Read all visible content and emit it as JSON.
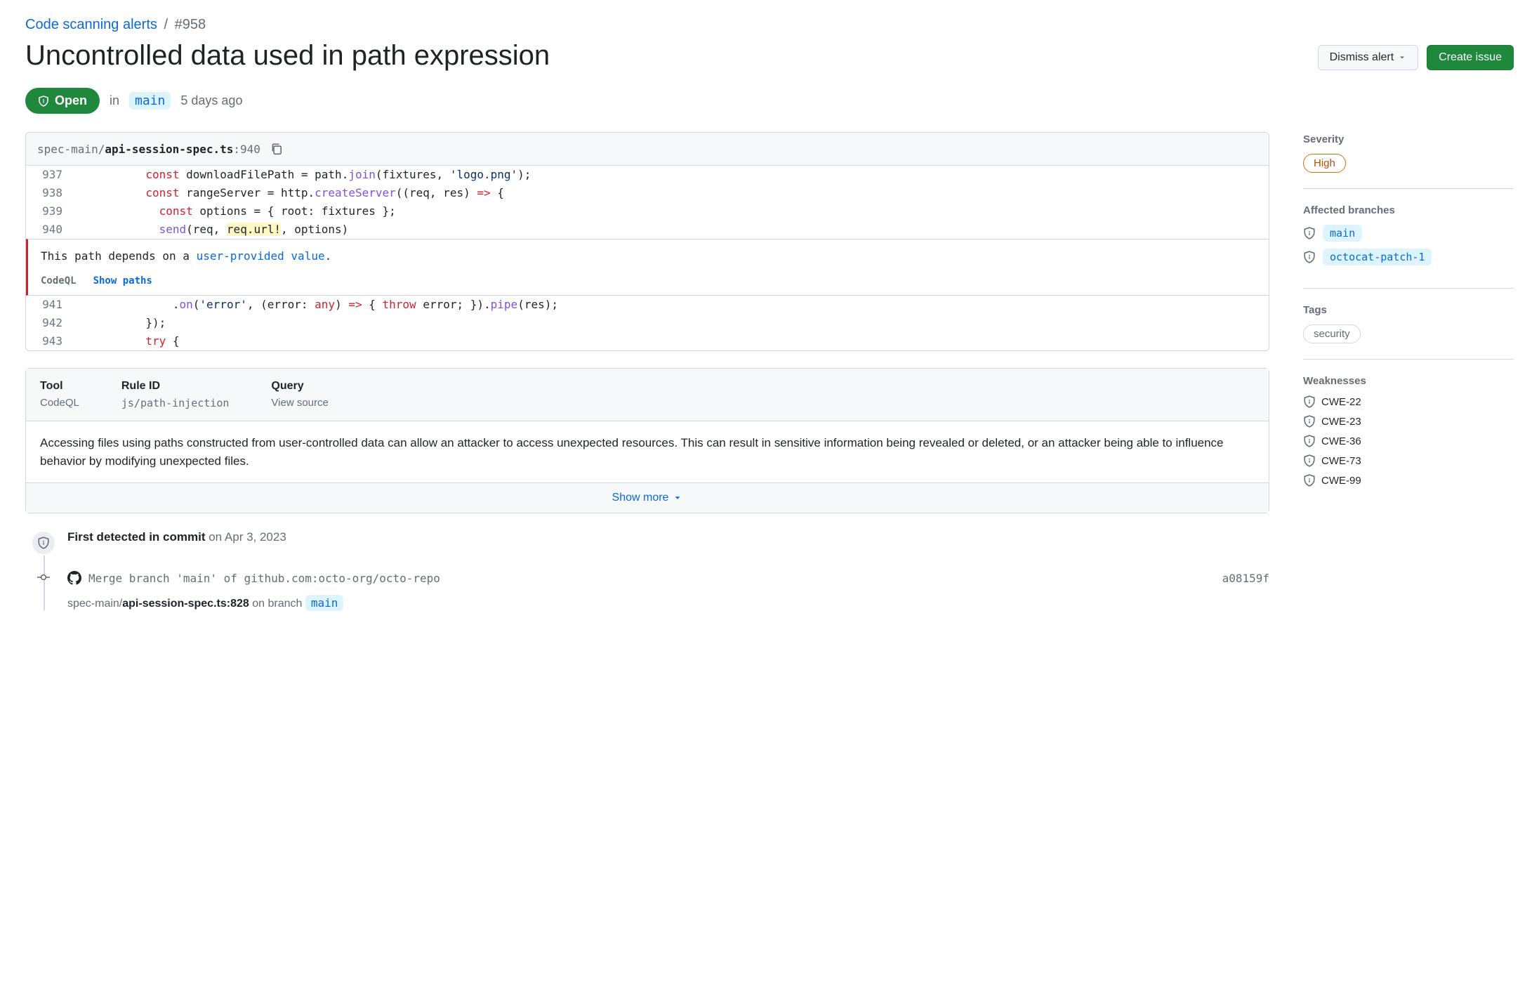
{
  "breadcrumb": {
    "parent": "Code scanning alerts",
    "id": "#958"
  },
  "title": "Uncontrolled data used in path expression",
  "actions": {
    "dismiss": "Dismiss alert",
    "create_issue": "Create issue"
  },
  "status": {
    "state": "Open",
    "in": "in",
    "branch": "main",
    "age": "5 days ago"
  },
  "code": {
    "path_prefix": "spec-main/",
    "file": "api-session-spec.ts",
    "line_sep": ":",
    "line": "940",
    "lines_before": [
      {
        "n": "937",
        "tokens": [
          [
            "pad",
            "          "
          ],
          [
            "kw",
            "const"
          ],
          [
            "txt",
            " downloadFilePath = path."
          ],
          [
            "fn",
            "join"
          ],
          [
            "txt",
            "(fixtures, "
          ],
          [
            "str",
            "'logo.png'"
          ],
          [
            "txt",
            ");"
          ]
        ]
      },
      {
        "n": "938",
        "tokens": [
          [
            "pad",
            "          "
          ],
          [
            "kw",
            "const"
          ],
          [
            "txt",
            " rangeServer = http."
          ],
          [
            "fn",
            "createServer"
          ],
          [
            "txt",
            "((req, res) "
          ],
          [
            "kw",
            "=>"
          ],
          [
            "txt",
            " {"
          ]
        ]
      },
      {
        "n": "939",
        "tokens": [
          [
            "pad",
            "            "
          ],
          [
            "kw",
            "const"
          ],
          [
            "txt",
            " options = { root: fixtures };"
          ]
        ]
      },
      {
        "n": "940",
        "tokens": [
          [
            "pad",
            "            "
          ],
          [
            "fn",
            "send"
          ],
          [
            "txt",
            "(req, "
          ],
          [
            "hl",
            "req.url!"
          ],
          [
            "txt",
            ", options)"
          ]
        ]
      }
    ],
    "lines_after": [
      {
        "n": "941",
        "tokens": [
          [
            "pad",
            "              "
          ],
          [
            "txt",
            "."
          ],
          [
            "fn",
            "on"
          ],
          [
            "txt",
            "("
          ],
          [
            "str",
            "'error'"
          ],
          [
            "txt",
            ", (error: "
          ],
          [
            "kw",
            "any"
          ],
          [
            "txt",
            ") "
          ],
          [
            "kw",
            "=>"
          ],
          [
            "txt",
            " { "
          ],
          [
            "kw",
            "throw"
          ],
          [
            "txt",
            " error; })."
          ],
          [
            "fn",
            "pipe"
          ],
          [
            "txt",
            "(res);"
          ]
        ]
      },
      {
        "n": "942",
        "tokens": [
          [
            "pad",
            "          "
          ],
          [
            "txt",
            "});"
          ]
        ]
      },
      {
        "n": "943",
        "tokens": [
          [
            "pad",
            "          "
          ],
          [
            "kw",
            "try"
          ],
          [
            "txt",
            " {"
          ]
        ]
      }
    ],
    "message": {
      "pre": "This path depends on a ",
      "link": "user-provided value",
      "post": "."
    },
    "tool_label": "CodeQL",
    "show_paths": "Show paths"
  },
  "details": {
    "cols": [
      {
        "h": "Tool",
        "v": "CodeQL"
      },
      {
        "h": "Rule ID",
        "v": "js/path-injection"
      },
      {
        "h": "Query",
        "v": "View source"
      }
    ],
    "body": "Accessing files using paths constructed from user-controlled data can allow an attacker to access unexpected resources. This can result in sensitive information being revealed or deleted, or an attacker being able to influence behavior by modifying unexpected files.",
    "show_more": "Show more"
  },
  "sidebar": {
    "severity": {
      "h": "Severity",
      "value": "High"
    },
    "branches": {
      "h": "Affected branches",
      "items": [
        "main",
        "octocat-patch-1"
      ]
    },
    "tags": {
      "h": "Tags",
      "items": [
        "security"
      ]
    },
    "weaknesses": {
      "h": "Weaknesses",
      "items": [
        "CWE-22",
        "CWE-23",
        "CWE-36",
        "CWE-73",
        "CWE-99"
      ]
    }
  },
  "timeline": {
    "detected": {
      "strong": "First detected in commit",
      "rest": " on Apr 3, 2023"
    },
    "commit": {
      "msg": "Merge branch 'main' of github.com:octo-org/octo-repo",
      "sha": "a08159f"
    },
    "file": {
      "path_prefix": "spec-main/",
      "file": "api-session-spec.ts:828",
      "rest": " on branch ",
      "branch": "main"
    }
  }
}
